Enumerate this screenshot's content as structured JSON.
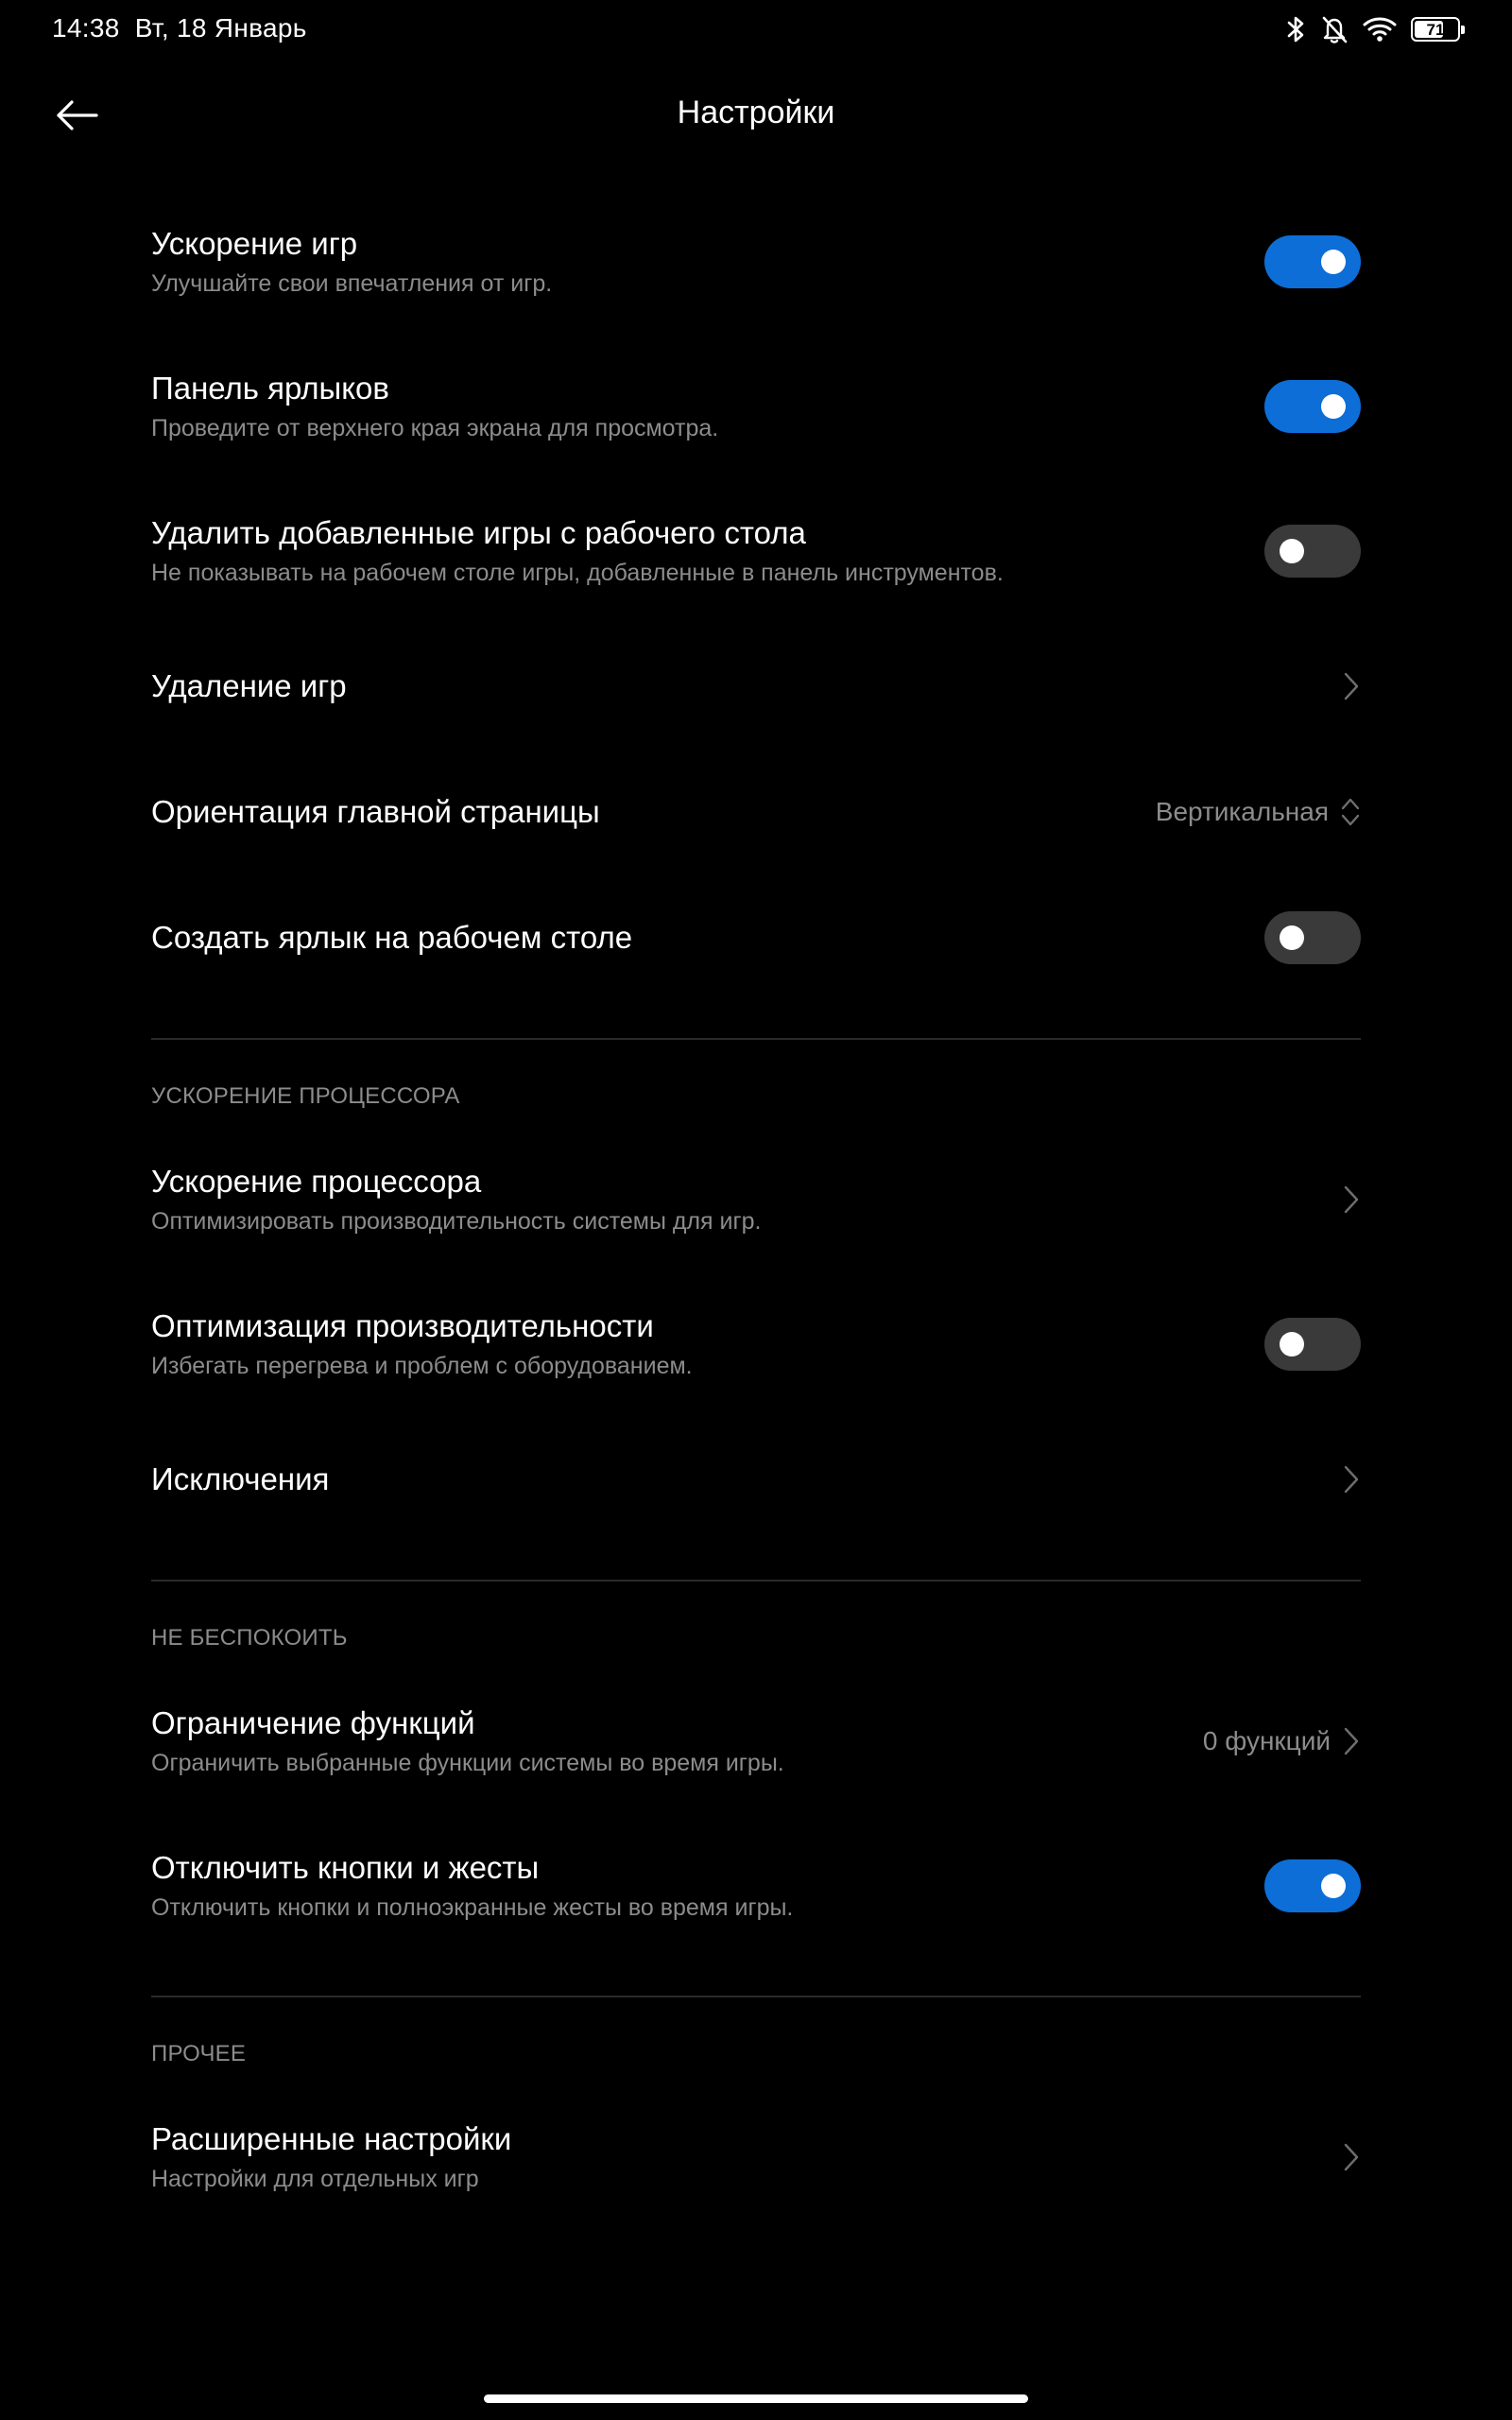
{
  "status_bar": {
    "time": "14:38",
    "date": "Вт, 18 Январь",
    "battery_level": "71",
    "icons": [
      "bluetooth-icon",
      "bell-muted-icon",
      "wifi-icon",
      "battery-icon"
    ]
  },
  "header": {
    "title": "Настройки",
    "back_icon": "arrow-left-icon"
  },
  "colors": {
    "background": "#000000",
    "accent": "#0d6ed8",
    "toggle_off": "#3a3a3a",
    "secondary_text": "#8c8c8c"
  },
  "settings": {
    "game_boost": {
      "title": "Ускорение игр",
      "subtitle": "Улучшайте свои впечатления от игр.",
      "enabled": true
    },
    "shortcut_panel": {
      "title": "Панель ярлыков",
      "subtitle": "Проведите от верхнего края экрана для просмотра.",
      "enabled": true
    },
    "remove_from_desktop": {
      "title": "Удалить добавленные игры с рабочего стола",
      "subtitle": "Не показывать на рабочем столе игры, добавленные в панель инструментов.",
      "enabled": false
    },
    "delete_games": {
      "title": "Удаление игр"
    },
    "home_orientation": {
      "title": "Ориентация главной страницы",
      "value": "Вертикальная"
    },
    "create_shortcut": {
      "title": "Создать ярлык на рабочем столе",
      "enabled": false
    }
  },
  "cpu_section": {
    "header": "УСКОРЕНИЕ ПРОЦЕССОРА",
    "cpu_boost": {
      "title": "Ускорение процессора",
      "subtitle": "Оптимизировать производительность системы для игр."
    },
    "performance_optimization": {
      "title": "Оптимизация производительности",
      "subtitle": "Избегать перегрева и проблем с оборудованием.",
      "enabled": false
    },
    "exceptions": {
      "title": "Исключения"
    }
  },
  "dnd_section": {
    "header": "НЕ БЕСПОКОИТЬ",
    "function_limit": {
      "title": "Ограничение функций",
      "subtitle": "Ограничить выбранные функции системы во время игры.",
      "value": "0 функций"
    },
    "disable_buttons": {
      "title": "Отключить кнопки и жесты",
      "subtitle": "Отключить кнопки и полноэкранные жесты во время игры.",
      "enabled": true
    }
  },
  "other_section": {
    "header": "ПРОЧЕЕ",
    "advanced": {
      "title": "Расширенные настройки",
      "subtitle": "Настройки для отдельных игр"
    }
  }
}
